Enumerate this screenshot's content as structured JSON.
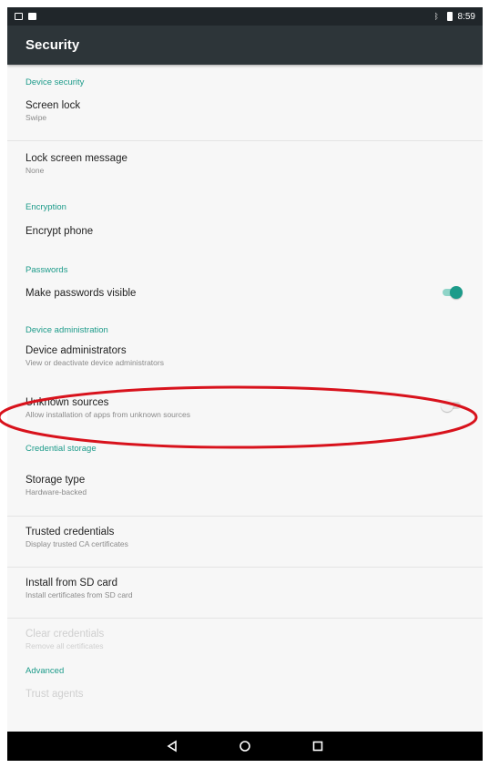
{
  "status_bar": {
    "time": "8:59"
  },
  "app_bar": {
    "title": "Security"
  },
  "sections": {
    "device_security": {
      "header": "Device security",
      "screen_lock": {
        "title": "Screen lock",
        "summary": "Swipe"
      },
      "lock_screen_message": {
        "title": "Lock screen message",
        "summary": "None"
      }
    },
    "encryption": {
      "header": "Encryption",
      "encrypt_phone": {
        "title": "Encrypt phone"
      }
    },
    "passwords": {
      "header": "Passwords",
      "make_visible": {
        "title": "Make passwords visible",
        "enabled": true
      }
    },
    "device_admin": {
      "header": "Device administration",
      "administrators": {
        "title": "Device administrators",
        "summary": "View or deactivate device administrators"
      },
      "unknown_sources": {
        "title": "Unknown sources",
        "summary": "Allow installation of apps from unknown sources",
        "enabled": false
      }
    },
    "credential_storage": {
      "header": "Credential storage",
      "storage_type": {
        "title": "Storage type",
        "summary": "Hardware-backed"
      },
      "trusted_credentials": {
        "title": "Trusted credentials",
        "summary": "Display trusted CA certificates"
      },
      "install_sd": {
        "title": "Install from SD card",
        "summary": "Install certificates from SD card"
      },
      "clear_credentials": {
        "title": "Clear credentials",
        "summary": "Remove all certificates"
      }
    },
    "advanced": {
      "header": "Advanced",
      "trust_agents": {
        "title": "Trust agents"
      }
    }
  },
  "colors": {
    "accent": "#1d9b8a",
    "app_bar": "#2d3539",
    "status_bar": "#20262a",
    "annotation": "#d8121c"
  },
  "icons": {
    "status_left": [
      "screen-icon",
      "sd-card-icon"
    ],
    "status_right": [
      "bluetooth-icon",
      "battery-icon"
    ],
    "navigation": [
      "back-icon",
      "home-icon",
      "recents-icon"
    ]
  }
}
